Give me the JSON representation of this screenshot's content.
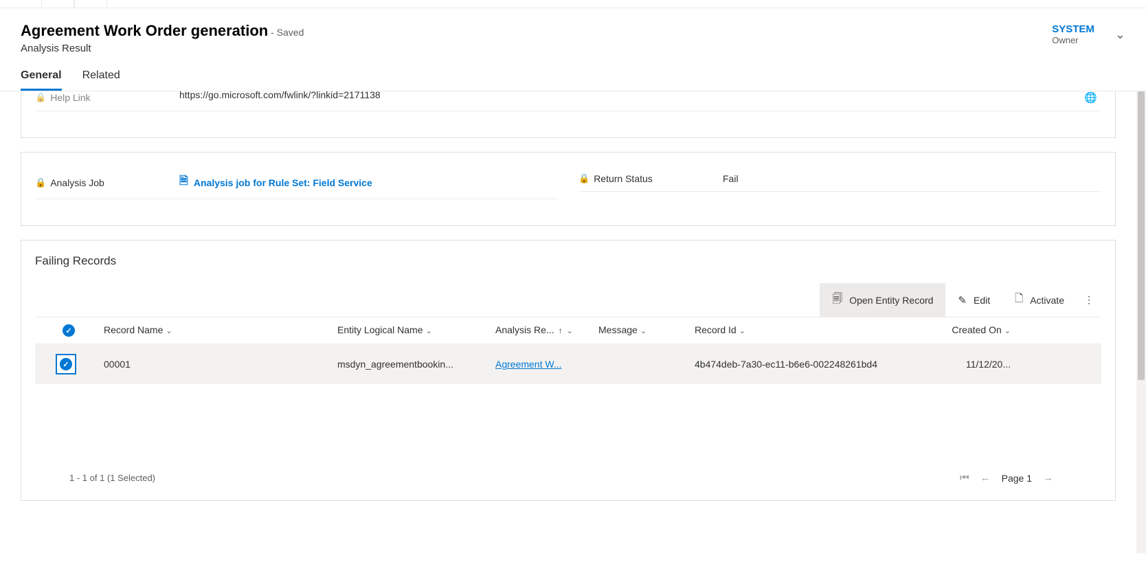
{
  "header": {
    "title": "Agreement Work Order generation",
    "saved": "- Saved",
    "subtitle": "Analysis Result",
    "owner_value": "SYSTEM",
    "owner_label": "Owner"
  },
  "tabs": {
    "general": "General",
    "related": "Related"
  },
  "fields": {
    "help_link_label": "Help Link",
    "help_link_value": "https://go.microsoft.com/fwlink/?linkid=2171138",
    "analysis_job_label": "Analysis Job",
    "analysis_job_value": "Analysis job for Rule Set: Field Service",
    "return_status_label": "Return Status",
    "return_status_value": "Fail"
  },
  "section": {
    "failing_records": "Failing Records"
  },
  "toolbar": {
    "open_entity": "Open Entity Record",
    "edit": "Edit",
    "activate": "Activate"
  },
  "columns": {
    "record_name": "Record Name",
    "entity": "Entity Logical Name",
    "analysis": "Analysis Re...",
    "message": "Message",
    "record_id": "Record Id",
    "created_on": "Created On"
  },
  "rows": [
    {
      "name": "00001",
      "entity": "msdyn_agreementbookin...",
      "analysis": "Agreement W...",
      "message": "",
      "record_id": "4b474deb-7a30-ec11-b6e6-002248261bd4",
      "created_on": "11/12/20..."
    }
  ],
  "footer": {
    "count": "1 - 1 of 1 (1 Selected)",
    "page": "Page 1"
  }
}
